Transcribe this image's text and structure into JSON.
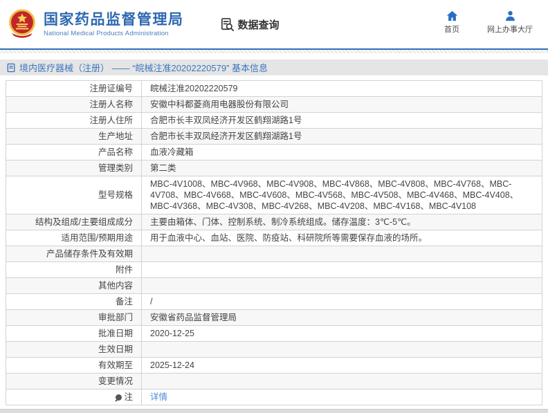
{
  "header": {
    "org_name": "国家药品监督管理局",
    "org_name_en": "National Medical Products Administration",
    "nav_data_query": "数据查询",
    "nav_home": "首页",
    "nav_service_hall": "网上办事大厅"
  },
  "breadcrumb": {
    "text": "境内医疗器械（注册） —— “皖械注准20202220579” 基本信息"
  },
  "table": {
    "rows": [
      {
        "label": "注册证编号",
        "value": "皖械注准20202220579"
      },
      {
        "label": "注册人名称",
        "value": "安徽中科都菱商用电器股份有限公司"
      },
      {
        "label": "注册人住所",
        "value": "合肥市长丰双凤经济开发区鹤翔湖路1号"
      },
      {
        "label": "生产地址",
        "value": "合肥市长丰双凤经济开发区鹤翔湖路1号"
      },
      {
        "label": "产品名称",
        "value": "血液冷藏箱"
      },
      {
        "label": "管理类别",
        "value": "第二类"
      },
      {
        "label": "型号规格",
        "value": "MBC-4V1008、MBC-4V968、MBC-4V908、MBC-4V868、MBC-4V808、MBC-4V768、MBC-4V708、MBC-4V668、MBC-4V608、MBC-4V568、MBC-4V508、MBC-4V468、MBC-4V408、MBC-4V368、MBC-4V308、MBC-4V268、MBC-4V208、MBC-4V168、MBC-4V108"
      },
      {
        "label": "结构及组成/主要组成成分",
        "value": "主要由箱体、门体、控制系统、制冷系统组成。储存温度：3℃-5℃。"
      },
      {
        "label": "适用范围/预期用途",
        "value": "用于血液中心、血站、医院、防疫站、科研院所等需要保存血液的场所。"
      },
      {
        "label": "产品储存条件及有效期",
        "value": ""
      },
      {
        "label": "附件",
        "value": ""
      },
      {
        "label": "其他内容",
        "value": ""
      },
      {
        "label": "备注",
        "value": "/"
      },
      {
        "label": "审批部门",
        "value": "安徽省药品监督管理局"
      },
      {
        "label": "批准日期",
        "value": "2020-12-25"
      },
      {
        "label": "生效日期",
        "value": ""
      },
      {
        "label": "有效期至",
        "value": "2025-12-24"
      },
      {
        "label": "变更情况",
        "value": ""
      },
      {
        "label": "注",
        "value": "详情",
        "is_link": true,
        "has_note_icon": true
      }
    ]
  },
  "colors": {
    "brand_blue": "#2d68b1",
    "divider_blue": "#2e6fb7",
    "link_blue": "#4b8bd4",
    "breadcrumb_text": "#3d76bd",
    "zebra_gray": "#f7f7f7",
    "emblem_red": "#c2262b",
    "emblem_gold": "#f0c040"
  }
}
